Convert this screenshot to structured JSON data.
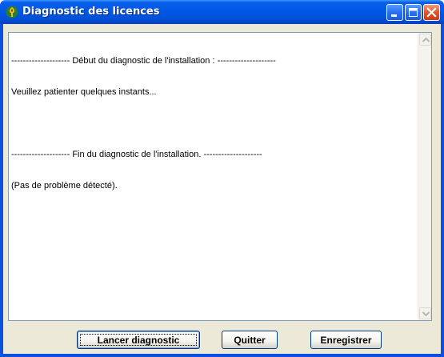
{
  "window": {
    "title": "Diagnostic des licences",
    "icon": "tree-app-icon"
  },
  "titlebar_buttons": [
    "minimize",
    "maximize",
    "close"
  ],
  "log": {
    "lines": [
      "-------------------- Début du diagnostic de l'installation : --------------------",
      "Veuillez patienter quelques instants...",
      "",
      "-------------------- Fin du diagnostic de l'installation. --------------------",
      "(Pas de problème détecté)."
    ]
  },
  "buttons": {
    "launch": "Lancer diagnostic",
    "quit": "Quitter",
    "save": "Enregistrer"
  },
  "colors": {
    "titlebar": "#0058e6",
    "face": "#ece9d8",
    "close": "#e0552a"
  }
}
